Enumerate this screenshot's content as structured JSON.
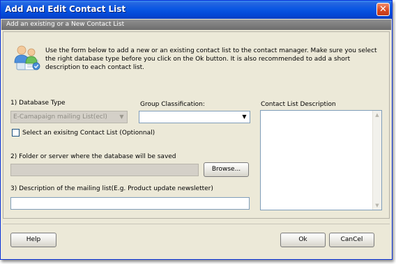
{
  "window": {
    "title": "Add And Edit Contact List",
    "close_glyph": "✕",
    "subheader": "Add an existing or a New Contact List"
  },
  "intro": {
    "icon": "users-contacts-icon",
    "text": "Use the form below to add a new or an existing contact list to the contact manager. Make sure you select the right database type before you click on the Ok button. It is also recommended to add a short description to each contact list."
  },
  "form": {
    "database_type_label": "1) Database Type",
    "database_type_value": "E-Camapaign mailing List(ecl)",
    "group_label": "Group Classification:",
    "group_value": "",
    "existing_checkbox_label": "Select an exisitng Contact List (Optionnal)",
    "existing_checked": false,
    "folder_label": "2) Folder or server where the database will be saved",
    "folder_value": "",
    "browse_label": "Browse...",
    "description_label": "3) Description of the mailing list(E.g. Product update newsletter)",
    "description_value": "",
    "contact_desc_label": "Contact List Description",
    "contact_desc_value": "",
    "dropdown_glyph": "▼",
    "scroll_up_glyph": "▲",
    "scroll_down_glyph": "▼"
  },
  "footer": {
    "help_label": "Help",
    "ok_label": "Ok",
    "cancel_label": "CanCel"
  },
  "colors": {
    "titlebar": "#0a57e3",
    "window_bg": "#ece9d8",
    "subheader_bg": "#7a7a7a",
    "close_button": "#d94b23"
  }
}
